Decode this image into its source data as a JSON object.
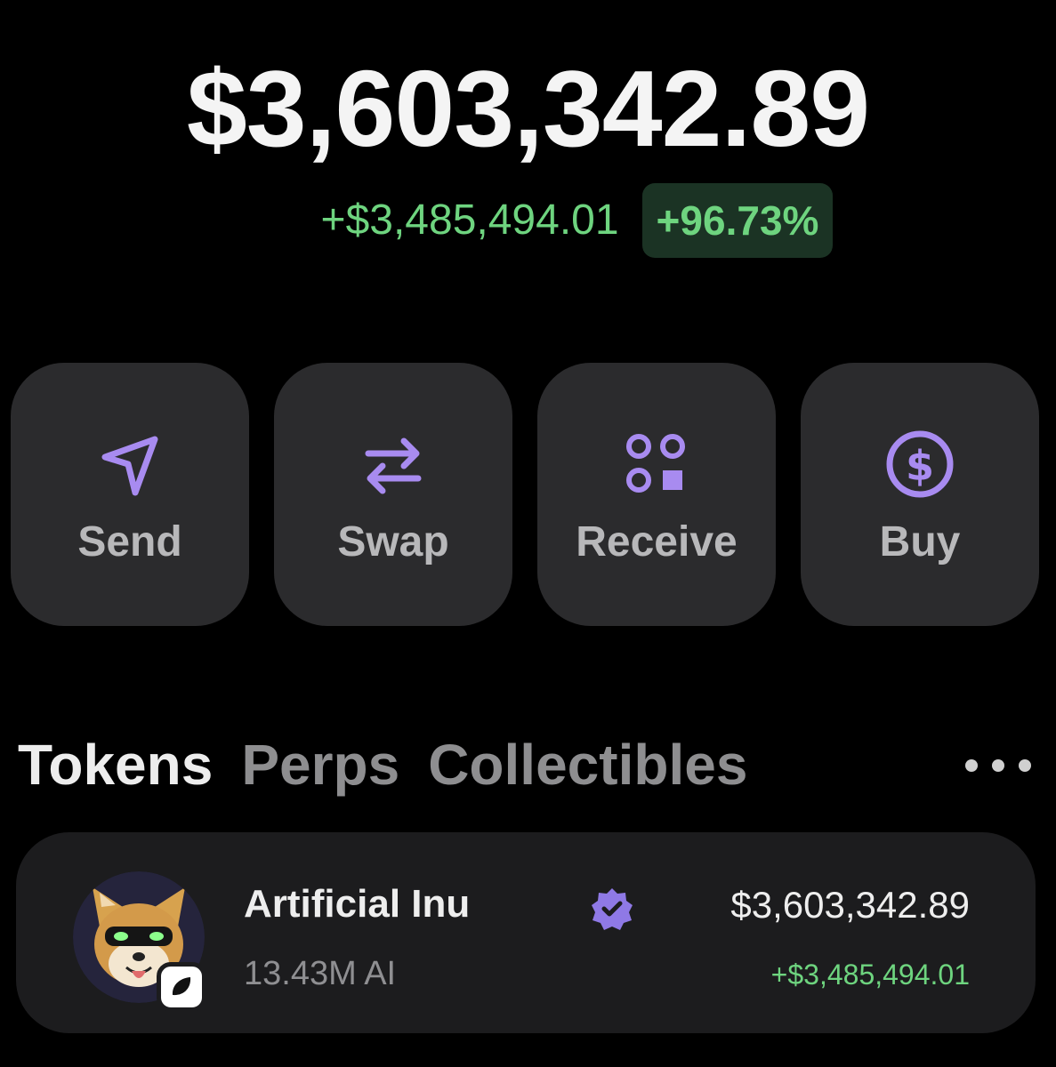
{
  "portfolio": {
    "balance": "$3,603,342.89",
    "change_amount": "+$3,485,494.01",
    "change_percent": "+96.73%"
  },
  "actions": [
    {
      "label": "Send",
      "icon": "send-icon"
    },
    {
      "label": "Swap",
      "icon": "swap-icon"
    },
    {
      "label": "Receive",
      "icon": "receive-icon"
    },
    {
      "label": "Buy",
      "icon": "dollar-icon"
    }
  ],
  "tabs": [
    {
      "label": "Tokens",
      "active": true
    },
    {
      "label": "Perps",
      "active": false
    },
    {
      "label": "Collectibles",
      "active": false
    }
  ],
  "more_icon": "more-horizontal-icon",
  "tokens": [
    {
      "name": "Artificial Inu",
      "balance": "13.43M AI",
      "value": "$3,603,342.89",
      "change": "+$3,485,494.01",
      "verified": true,
      "avatar_icon": "shiba-dog-avatar",
      "chain_icon": "chain-badge-icon"
    }
  ],
  "colors": {
    "background": "#000000",
    "accent_purple": "#a88bf0",
    "positive_green": "#6ed47f",
    "card": "#2b2b2d"
  }
}
